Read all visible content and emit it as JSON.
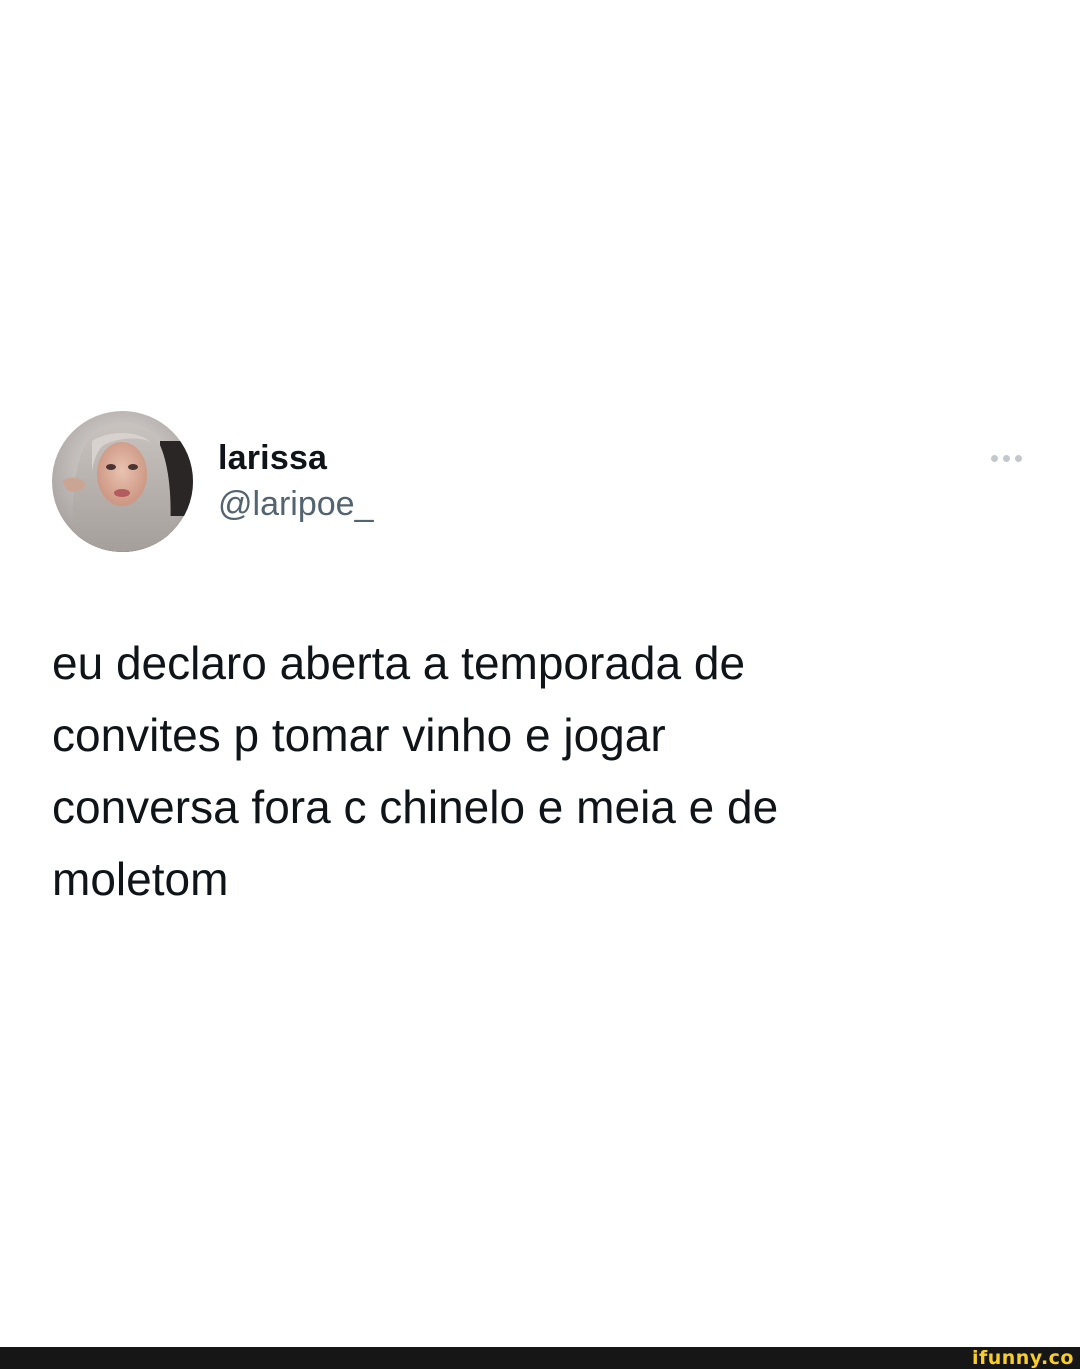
{
  "tweet": {
    "display_name": "larissa",
    "handle": "@laripoe_",
    "text": "eu declaro aberta a temporada de\nconvites p tomar vinho e jogar\nconversa fora c chinelo e meia e de\nmoletom",
    "more_icon": "more-horizontal-icon"
  },
  "watermark": {
    "text": "ifunny.co"
  },
  "colors": {
    "name": "#0f1419",
    "handle": "#536471",
    "more_dots": "#c3c8cd",
    "footer_bar": "#161616",
    "watermark": "#f7cd2b"
  }
}
